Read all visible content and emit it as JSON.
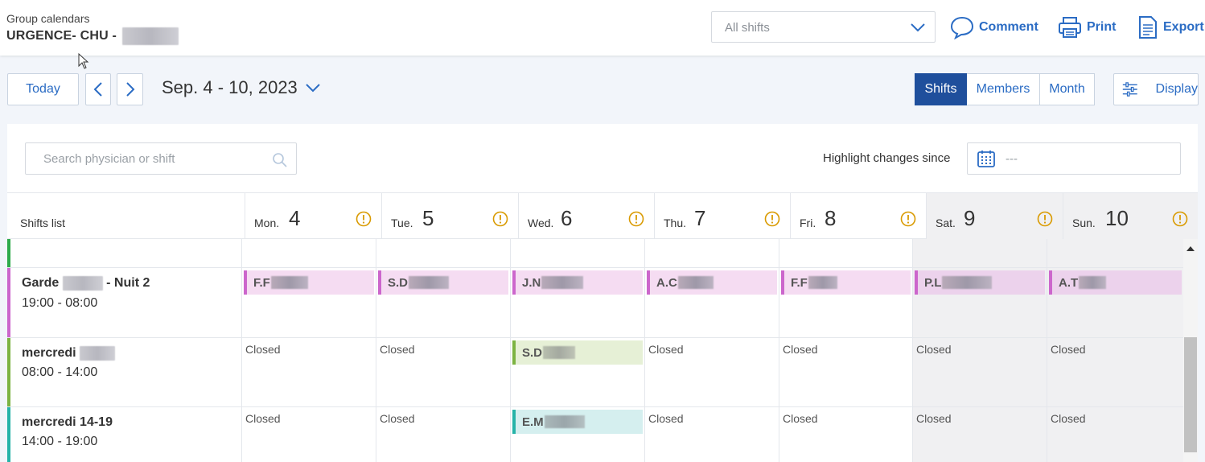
{
  "header": {
    "group_label": "Group calendars",
    "group_name": "URGENCE- CHU -",
    "shift_filter": {
      "value": "All shifts"
    },
    "actions": [
      {
        "label": "Comment",
        "icon": "comment-icon"
      },
      {
        "label": "Print",
        "icon": "printer-icon"
      },
      {
        "label": "Export",
        "icon": "export-icon"
      }
    ]
  },
  "toolbar": {
    "today_label": "Today",
    "date_range": "Sep. 4 - 10, 2023",
    "views": [
      {
        "label": "Shifts",
        "active": true
      },
      {
        "label": "Members",
        "active": false
      },
      {
        "label": "Month",
        "active": false
      }
    ],
    "display_label": "Display"
  },
  "panel": {
    "search_placeholder": "Search physician or shift",
    "highlight_label": "Highlight changes since",
    "highlight_value": "---",
    "shifts_list_label": "Shifts list",
    "days": [
      {
        "name": "Mon.",
        "num": "4",
        "weekend": false
      },
      {
        "name": "Tue.",
        "num": "5",
        "weekend": false
      },
      {
        "name": "Wed.",
        "num": "6",
        "weekend": false
      },
      {
        "name": "Thu.",
        "num": "7",
        "weekend": false
      },
      {
        "name": "Fri.",
        "num": "8",
        "weekend": false
      },
      {
        "name": "Sat.",
        "num": "9",
        "weekend": true
      },
      {
        "name": "Sun.",
        "num": "10",
        "weekend": true
      }
    ],
    "closed_label": "Closed",
    "rows": [
      {
        "title_prefix": "Garde",
        "title_suffix": "- Nuit 2",
        "time": "19:00 - 08:00",
        "color": "#cc66cc",
        "chip_bg": "#f5dcf2",
        "cells": [
          "F.F",
          "S.D",
          "J.N",
          "A.C",
          "F.F",
          "P.L",
          "A.T"
        ]
      },
      {
        "title_prefix": "mercredi",
        "title_suffix": "",
        "time": "08:00 - 14:00",
        "color": "#7cb342",
        "chip_bg": "#e6f0d6",
        "cells": [
          "Closed",
          "Closed",
          "S.D",
          "Closed",
          "Closed",
          "Closed",
          "Closed"
        ]
      },
      {
        "title_prefix": "mercredi 14-19",
        "title_suffix": "",
        "time": "14:00 - 19:00",
        "color": "#26b3a8",
        "chip_bg": "#d5efef",
        "cells": [
          "Closed",
          "Closed",
          "E.M",
          "Closed",
          "Closed",
          "Closed",
          "Closed"
        ]
      }
    ]
  },
  "colors": {
    "accent": "#2b6cc4",
    "active_view": "#1f4f9c",
    "warning": "#d99a00"
  }
}
